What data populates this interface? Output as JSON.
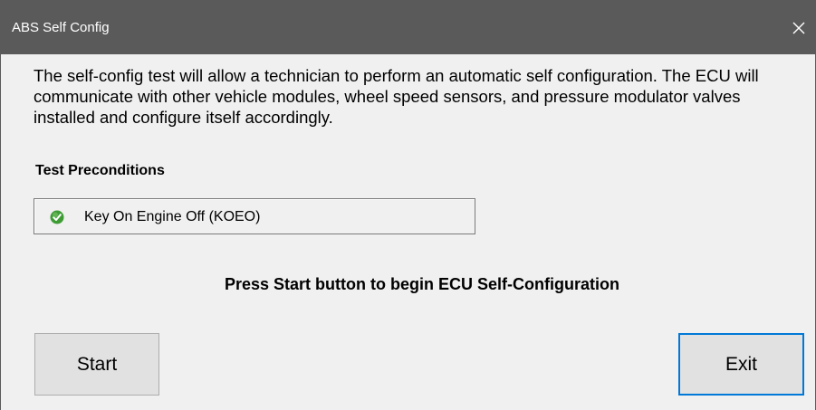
{
  "window": {
    "title": "ABS Self Config",
    "close_glyph": "×"
  },
  "description": "The self-config test will allow a technician to perform an automatic self configuration. The ECU will communicate with other vehicle modules, wheel speed sensors, and pressure modulator valves installed and configure itself accordingly.",
  "preconditions": {
    "heading": "Test Preconditions",
    "items": [
      {
        "label": "Key On Engine Off (KOEO)",
        "status": "passed",
        "icon": "green-check-icon"
      }
    ]
  },
  "instruction": "Press Start button to begin ECU Self-Configuration",
  "buttons": {
    "start_label": "Start",
    "exit_label": "Exit"
  },
  "colors": {
    "titlebar": "#5a5a5a",
    "focus_border": "#0078d7",
    "check_green": "#3f9c35"
  }
}
